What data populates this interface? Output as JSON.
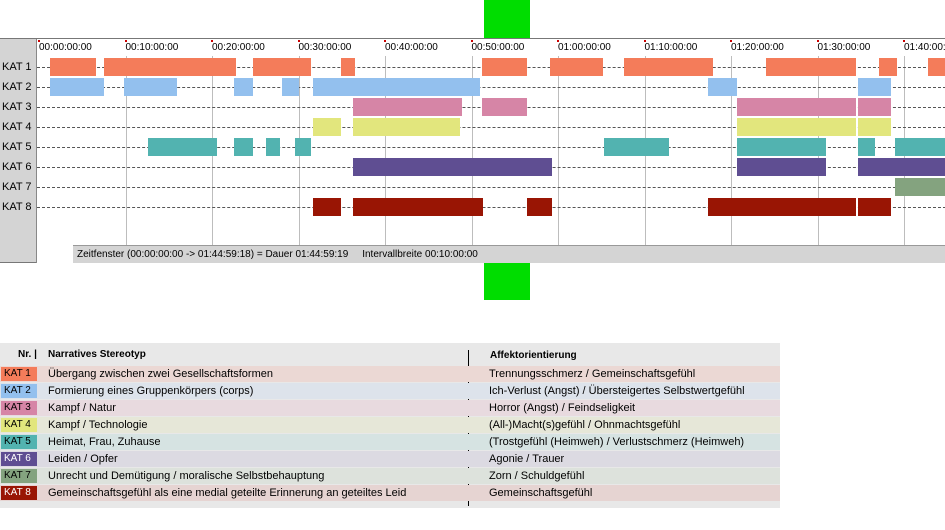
{
  "timeline": {
    "time_labels": [
      "00:00:00:00",
      "00:10:00:00",
      "00:20:00:00",
      "00:30:00:00",
      "00:40:00:00",
      "00:50:00:00",
      "01:00:00:00",
      "01:10:00:00",
      "01:20:00:00",
      "01:30:00:00",
      "01:40:00:00"
    ],
    "status_window": "Zeitfenster (00:00:00:00 -> 01:44:59:18) = Dauer 01:44:59:19",
    "status_interval": "Intervallbreite 00:10:00:00",
    "rows": [
      {
        "label": "KAT 1",
        "color": "#f47c5a",
        "segments": [
          [
            1.5,
            6.8
          ],
          [
            7.7,
            23.0
          ],
          [
            25.0,
            31.7
          ],
          [
            35.2,
            36.8
          ],
          [
            51.4,
            56.6
          ],
          [
            59.3,
            65.4
          ],
          [
            67.9,
            78.2
          ],
          [
            84.3,
            94.7
          ],
          [
            97.3,
            99.4
          ],
          [
            103.0,
            109.7
          ]
        ]
      },
      {
        "label": "KAT 2",
        "color": "#93c0ee",
        "segments": [
          [
            1.5,
            7.7
          ],
          [
            10.1,
            16.2
          ],
          [
            22.8,
            25.0
          ],
          [
            28.3,
            30.3
          ],
          [
            31.9,
            51.2
          ],
          [
            77.6,
            80.9
          ],
          [
            94.9,
            98.7
          ]
        ]
      },
      {
        "label": "KAT 3",
        "color": "#d685a6",
        "segments": [
          [
            36.5,
            49.1
          ],
          [
            51.4,
            56.6
          ],
          [
            80.9,
            94.7
          ],
          [
            94.9,
            98.7
          ]
        ]
      },
      {
        "label": "KAT 4",
        "color": "#e2e67d",
        "segments": [
          [
            31.9,
            35.2
          ],
          [
            36.5,
            48.9
          ],
          [
            80.9,
            94.7
          ],
          [
            94.9,
            98.7
          ]
        ]
      },
      {
        "label": "KAT 5",
        "color": "#52b3b0",
        "segments": [
          [
            12.8,
            20.8
          ],
          [
            22.8,
            25.0
          ],
          [
            26.5,
            28.1
          ],
          [
            29.8,
            31.7
          ],
          [
            65.6,
            73.1
          ],
          [
            80.9,
            91.2
          ],
          [
            94.9,
            96.9
          ],
          [
            99.2,
            107.0
          ]
        ]
      },
      {
        "label": "KAT 6",
        "color": "#5f4e92",
        "segments": [
          [
            36.5,
            59.5
          ],
          [
            80.9,
            91.2
          ],
          [
            94.9,
            107.0
          ]
        ]
      },
      {
        "label": "KAT 7",
        "color": "#84a37f",
        "segments": [
          [
            99.2,
            107.0
          ]
        ]
      },
      {
        "label": "KAT 8",
        "color": "#991504",
        "segments": [
          [
            31.9,
            35.2
          ],
          [
            36.5,
            51.6
          ],
          [
            56.6,
            59.5
          ],
          [
            77.6,
            94.7
          ],
          [
            94.9,
            98.7
          ]
        ]
      }
    ]
  },
  "legend": {
    "header_nr": "Nr. |",
    "header_stereotype": "Narratives Stereotyp",
    "header_affekt": "Affektorientierung",
    "rows": [
      {
        "code": "KAT 1",
        "code_color": "#f47c5a",
        "code_text_color": "#000000",
        "row_color": "#ebd8d4",
        "stereotype": "Übergang zwischen zwei Gesellschaftsformen",
        "affekt": "Trennungsschmerz / Gemeinschaftsgefühl"
      },
      {
        "code": "KAT 2",
        "code_color": "#93c0ee",
        "code_text_color": "#000000",
        "row_color": "#dde3eb",
        "stereotype": "Formierung eines Gruppenkörpers (corps)",
        "affekt": "Ich-Verlust (Angst) / Übersteigertes Selbstwertgefühl"
      },
      {
        "code": "KAT 3",
        "code_color": "#d685a6",
        "code_text_color": "#000000",
        "row_color": "#e8dadf",
        "stereotype": "Kampf / Natur",
        "affekt": "Horror (Angst) / Feindseligkeit"
      },
      {
        "code": "KAT 4",
        "code_color": "#e2e67d",
        "code_text_color": "#000000",
        "row_color": "#e6e7d8",
        "stereotype": "Kampf / Technologie",
        "affekt": "(All-)Macht(s)gefühl / Ohnmachtsgefühl"
      },
      {
        "code": "KAT 5",
        "code_color": "#52b3b0",
        "code_text_color": "#000000",
        "row_color": "#d6e3e2",
        "stereotype": "Heimat, Frau, Zuhause",
        "affekt": "(Trostgefühl (Heimweh) / Verlustschmerz (Heimweh)"
      },
      {
        "code": "KAT 6",
        "code_color": "#5f4e92",
        "code_text_color": "#ffffff",
        "row_color": "#dcdae2",
        "stereotype": "Leiden / Opfer",
        "affekt": "Agonie / Trauer"
      },
      {
        "code": "KAT 7",
        "code_color": "#84a37f",
        "code_text_color": "#000000",
        "row_color": "#dde2dc",
        "stereotype": "Unrecht und Demütigung / moralische Selbstbehauptung",
        "affekt": "Zorn / Schuldgefühl"
      },
      {
        "code": "KAT 8",
        "code_color": "#991504",
        "code_text_color": "#ffffff",
        "row_color": "#e6d4d2",
        "stereotype": "Gemeinschaftsgefühl als eine medial geteilte Erinnerung an geteiltes Leid",
        "affekt": "Gemeinschaftsgefühl"
      }
    ]
  }
}
